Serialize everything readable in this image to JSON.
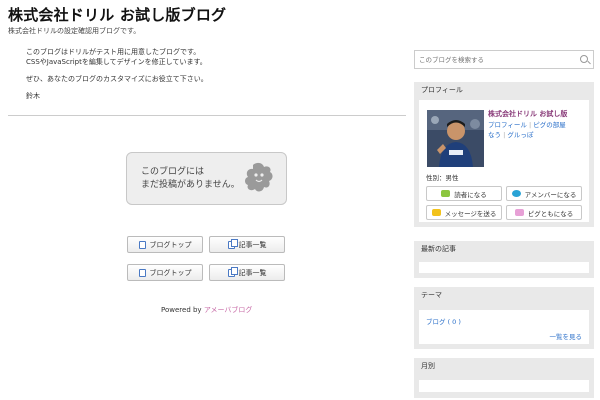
{
  "blog": {
    "title": "株式会社ドリル お試し版ブログ",
    "description": "株式会社ドリルの設定確認用ブログです。"
  },
  "intro": {
    "line1": "このブログはドリルがテスト用に用意したブログです。",
    "line2": "CSSやJavaScriptを編集してデザインを修正しています。",
    "line3": "ぜひ、あなたのブログのカスタマイズにお役立て下さい。",
    "signature": "鈴木"
  },
  "empty_state": {
    "line1": "このブログには",
    "line2": "まだ投稿がありません。"
  },
  "nav": {
    "blog_top": "ブログトップ",
    "article_list": "記事一覧"
  },
  "footer": {
    "powered_prefix": "Powered by",
    "powered_brand": "アメーバブログ"
  },
  "sidebar": {
    "search_placeholder": "このブログを検索する",
    "profile": {
      "heading": "プロフィール",
      "name": "株式会社ドリル お試し版",
      "link_profile": "プロフィール",
      "link_pigg": "ピグの部屋",
      "link_group": "なう",
      "link_gurupe": "グルっぽ",
      "separator": "|",
      "gender": "性別：男性",
      "buttons": {
        "reader": "読者になる",
        "amember": "アメンバーになる",
        "message": "メッセージを送る",
        "pigg_friend": "ピグともになる"
      }
    },
    "recent": {
      "heading": "最新の記事"
    },
    "theme": {
      "heading": "テーマ",
      "blog_link": "ブログ ( 0 )",
      "see_all": "一覧を見る"
    },
    "monthly": {
      "heading": "月別"
    }
  },
  "colors": {
    "link": "#2a6fc9",
    "profile_name": "#8a3c7a",
    "brand": "#c76aa6",
    "widget_bg": "#e9e9e9"
  }
}
